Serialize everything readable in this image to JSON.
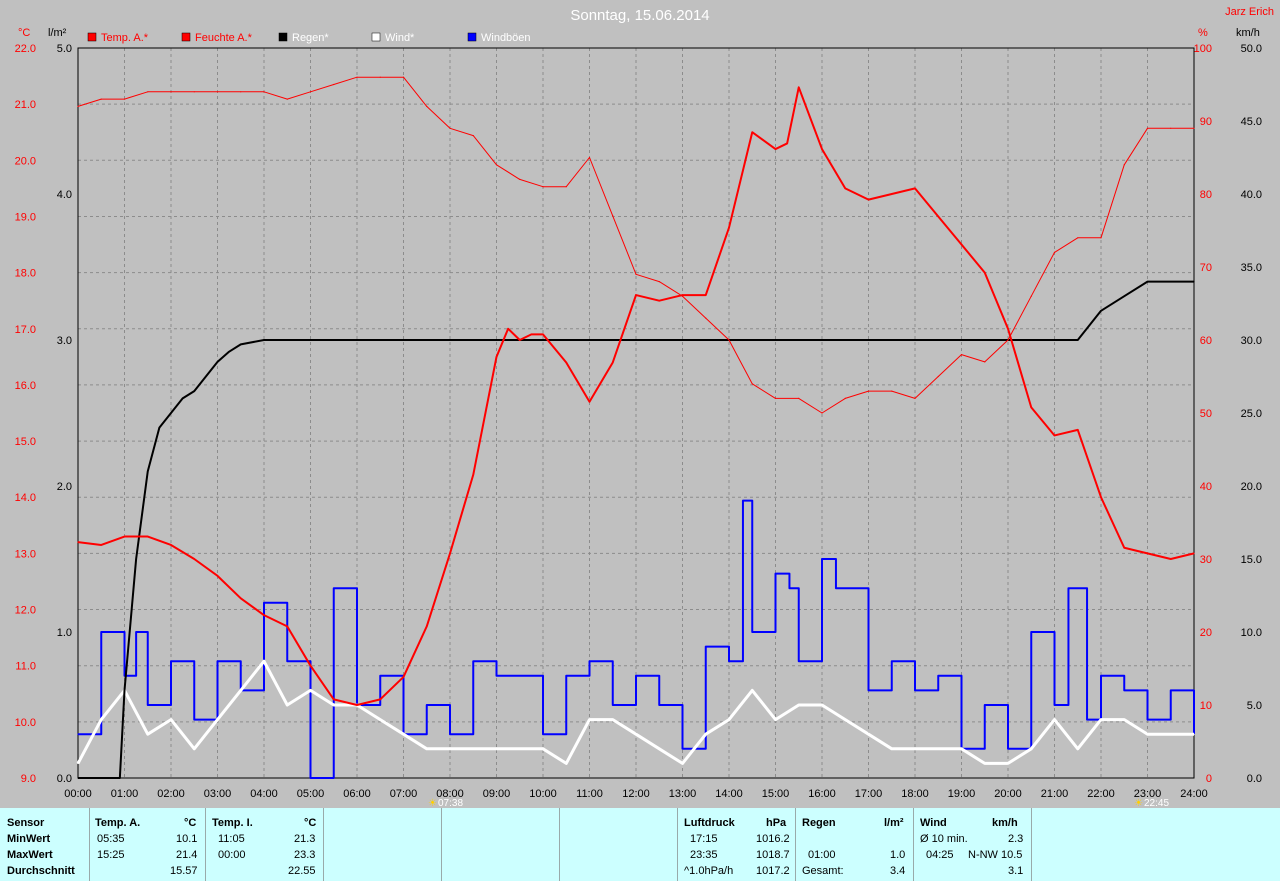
{
  "header": {
    "title": "Sonntag, 15.06.2014",
    "author": "Jarz Erich",
    "unit_left_temp": "°C",
    "unit_left_rain": "l/m²",
    "unit_right_pct": "%",
    "unit_right_wind": "km/h"
  },
  "legend": [
    {
      "label": "Temp. A.*",
      "color": "#ff0000"
    },
    {
      "label": "Feuchte A.*",
      "color": "#ff0000"
    },
    {
      "label": "Regen*",
      "color": "#000000"
    },
    {
      "label": "Wind*",
      "color": "#ffffff"
    },
    {
      "label": "Windböen",
      "color": "#0000ff"
    }
  ],
  "markers": {
    "sunrise": "07:38",
    "sunset": "22:45"
  },
  "colors": {
    "background": "#c0c0c0",
    "grid": "#8c8c8c",
    "temp": "#ff0000",
    "humidity": "#ff0000",
    "rain": "#000000",
    "wind": "#ffffff",
    "gust": "#0000ff",
    "stats_bg": "#ccffff"
  },
  "chart_data": {
    "type": "line",
    "title": "Sonntag, 15.06.2014",
    "x_range_hours": [
      0,
      24
    ],
    "x_ticks": [
      "00:00",
      "01:00",
      "02:00",
      "03:00",
      "04:00",
      "05:00",
      "06:00",
      "07:00",
      "08:00",
      "09:00",
      "10:00",
      "11:00",
      "12:00",
      "13:00",
      "14:00",
      "15:00",
      "16:00",
      "17:00",
      "18:00",
      "19:00",
      "20:00",
      "21:00",
      "22:00",
      "23:00",
      "24:00"
    ],
    "axes": {
      "temp": {
        "unit": "°C",
        "range": [
          9,
          22
        ],
        "ticks": [
          "9.0",
          "10.0",
          "11.0",
          "12.0",
          "13.0",
          "14.0",
          "15.0",
          "16.0",
          "17.0",
          "18.0",
          "19.0",
          "20.0",
          "21.0",
          "22.0"
        ]
      },
      "rain": {
        "unit": "l/m²",
        "range": [
          0,
          5
        ],
        "ticks": [
          "0.0",
          "1.0",
          "2.0",
          "3.0",
          "4.0",
          "5.0"
        ]
      },
      "humidity": {
        "unit": "%",
        "range": [
          0,
          100
        ],
        "ticks": [
          "0",
          "10",
          "20",
          "30",
          "40",
          "50",
          "60",
          "70",
          "80",
          "90",
          "100"
        ]
      },
      "wind": {
        "unit": "km/h",
        "range": [
          0,
          50
        ],
        "ticks": [
          "0.0",
          "5.0",
          "10.0",
          "15.0",
          "20.0",
          "25.0",
          "30.0",
          "35.0",
          "40.0",
          "45.0",
          "50.0"
        ]
      }
    },
    "grid": true,
    "series": [
      {
        "name": "Temp. A.*",
        "axis": "temp",
        "x": [
          0,
          0.5,
          1,
          1.5,
          2,
          2.5,
          3,
          3.5,
          4,
          4.5,
          5,
          5.5,
          6,
          6.5,
          7,
          7.5,
          8,
          8.5,
          9,
          9.25,
          9.5,
          9.75,
          10,
          10.5,
          11,
          11.5,
          12,
          12.5,
          13,
          13.5,
          14,
          14.5,
          15,
          15.25,
          15.5,
          16,
          16.5,
          17,
          17.5,
          18,
          18.5,
          19,
          19.5,
          20,
          20.5,
          21,
          21.5,
          22,
          22.5,
          23,
          23.5,
          24
        ],
        "y": [
          13.2,
          13.15,
          13.3,
          13.3,
          13.15,
          12.9,
          12.6,
          12.2,
          11.9,
          11.7,
          11.0,
          10.4,
          10.3,
          10.4,
          10.8,
          11.7,
          13.0,
          14.4,
          16.5,
          17.0,
          16.8,
          16.9,
          16.9,
          16.4,
          15.7,
          16.4,
          17.6,
          17.5,
          17.6,
          17.6,
          18.8,
          20.5,
          20.2,
          20.3,
          21.3,
          20.2,
          19.5,
          19.3,
          19.4,
          19.5,
          19.0,
          18.5,
          18.0,
          17.0,
          15.6,
          15.1,
          15.2,
          14.0,
          13.1,
          13.0,
          12.9,
          13.0
        ]
      },
      {
        "name": "Feuchte A.*",
        "axis": "humidity",
        "x": [
          0,
          0.5,
          1,
          1.5,
          2,
          2.5,
          3,
          3.5,
          4,
          4.5,
          5,
          5.5,
          6,
          6.5,
          7,
          7.5,
          8,
          8.5,
          9,
          9.5,
          10,
          10.5,
          11,
          11.5,
          12,
          12.5,
          13,
          13.5,
          14,
          14.5,
          15,
          15.5,
          16,
          16.5,
          17,
          17.5,
          18,
          18.5,
          19,
          19.5,
          20,
          20.5,
          21,
          21.5,
          22,
          22.5,
          23,
          23.5,
          24
        ],
        "y": [
          92,
          93,
          93,
          94,
          94,
          94,
          94,
          94,
          94,
          93,
          94,
          95,
          96,
          96,
          96,
          92,
          89,
          88,
          84,
          82,
          81,
          81,
          85,
          77,
          69,
          68,
          66,
          63,
          60,
          54,
          52,
          52,
          50,
          52,
          53,
          53,
          52,
          55,
          58,
          57,
          60,
          66,
          72,
          74,
          74,
          84,
          89,
          89,
          89
        ]
      },
      {
        "name": "Regen*",
        "axis": "rain",
        "x": [
          0,
          0.9,
          1,
          1.25,
          1.5,
          1.75,
          2,
          2.25,
          2.5,
          2.75,
          3,
          3.25,
          3.5,
          4,
          4.5,
          5,
          21.5,
          21.75,
          22,
          22.5,
          23,
          24
        ],
        "y": [
          0,
          0,
          0.6,
          1.5,
          2.1,
          2.4,
          2.5,
          2.6,
          2.65,
          2.75,
          2.85,
          2.92,
          2.97,
          3.0,
          3.0,
          3.0,
          3.0,
          3.1,
          3.2,
          3.3,
          3.4,
          3.4
        ]
      },
      {
        "name": "Wind*",
        "axis": "wind",
        "x": [
          0,
          0.5,
          1,
          1.5,
          2,
          2.5,
          3,
          3.5,
          4,
          4.5,
          5,
          5.5,
          6,
          6.5,
          7,
          7.5,
          8,
          8.5,
          9,
          9.5,
          10,
          10.5,
          11,
          11.5,
          12,
          12.5,
          13,
          13.5,
          14,
          14.5,
          15,
          15.5,
          16,
          16.5,
          17,
          17.5,
          18,
          18.5,
          19,
          19.5,
          20,
          20.5,
          21,
          21.5,
          22,
          22.5,
          23,
          23.5,
          24
        ],
        "y": [
          1,
          4,
          6,
          3,
          4,
          2,
          4,
          6,
          8,
          5,
          6,
          5,
          5,
          4,
          3,
          2,
          2,
          2,
          2,
          2,
          2,
          1,
          4,
          4,
          3,
          2,
          1,
          3,
          4,
          6,
          4,
          5,
          5,
          4,
          3,
          2,
          2,
          2,
          2,
          1,
          1,
          2,
          4,
          2,
          4,
          4,
          3,
          3,
          3
        ]
      },
      {
        "name": "Windböen",
        "axis": "wind",
        "x": [
          0,
          0.5,
          1,
          1.25,
          1.5,
          2,
          2.5,
          3,
          3.5,
          4,
          4.25,
          4.5,
          5,
          5.5,
          6,
          6.5,
          7,
          7.5,
          8,
          8.5,
          9,
          9.5,
          10,
          10.5,
          11,
          11.5,
          12,
          12.5,
          13,
          13.5,
          14,
          14.3,
          14.5,
          15,
          15.3,
          15.5,
          16,
          16.3,
          16.5,
          17,
          17.5,
          18,
          18.5,
          19,
          19.5,
          20,
          20.5,
          21,
          21.3,
          21.7,
          22,
          22.5,
          23,
          23.5,
          24
        ],
        "y": [
          3,
          10,
          7,
          10,
          5,
          8,
          4,
          8,
          6,
          12,
          12,
          8,
          0,
          13,
          5,
          7,
          3,
          5,
          3,
          8,
          7,
          7,
          3,
          7,
          8,
          5,
          7,
          5,
          2,
          9,
          8,
          19,
          10,
          14,
          13,
          8,
          15,
          13,
          13,
          6,
          8,
          6,
          7,
          2,
          5,
          2,
          10,
          5,
          13,
          4,
          7,
          6,
          4,
          6,
          3
        ]
      }
    ]
  },
  "stats": {
    "sensor": {
      "header": "Sensor",
      "min": "MinWert",
      "max": "MaxWert",
      "avg": "Durchschnitt"
    },
    "temp_a": {
      "header": "Temp. A.",
      "unit": "°C",
      "min_time": "05:35",
      "min_val": "10.1",
      "max_time": "15:25",
      "max_val": "21.4",
      "avg": "15.57"
    },
    "temp_i": {
      "header": "Temp. I.",
      "unit": "°C",
      "min_time": "11:05",
      "min_val": "21.3",
      "max_time": "00:00",
      "max_val": "23.3",
      "avg": "22.55"
    },
    "pressure": {
      "header": "Luftdruck",
      "unit": "hPa",
      "min_time": "17:15",
      "min_val": "1016.2",
      "max_time": "23:35",
      "max_val": "1018.7",
      "trend": "^1.0hPa/h",
      "trend_val": "1017.2"
    },
    "rain": {
      "header": "Regen",
      "unit": "l/m²",
      "max_time": "01:00",
      "max_val": "1.0",
      "total_label": "Gesamt:",
      "total_val": "3.4"
    },
    "wind": {
      "header": "Wind",
      "unit": "km/h",
      "avg10_label": "Ø 10 min.",
      "avg10_val": "2.3",
      "gust_time": "04:25",
      "gust_val": "N-NW 10.5",
      "avg_val": "3.1"
    }
  }
}
